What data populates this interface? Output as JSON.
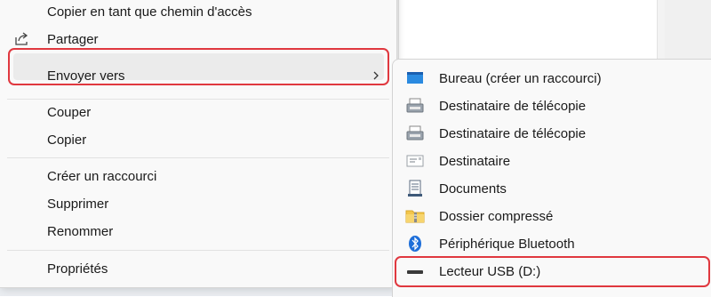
{
  "menu": {
    "items": [
      {
        "label": "Copier en tant que chemin d'accès",
        "icon": "copy-path-icon"
      },
      {
        "label": "Partager",
        "icon": "share-icon"
      },
      {
        "label": "Envoyer vers",
        "icon": "",
        "has_submenu": true,
        "highlighted": true
      },
      {
        "label": "Couper",
        "icon": ""
      },
      {
        "label": "Copier",
        "icon": ""
      },
      {
        "label": "Créer un raccourci",
        "icon": ""
      },
      {
        "label": "Supprimer",
        "icon": ""
      },
      {
        "label": "Renommer",
        "icon": ""
      },
      {
        "label": "Propriétés",
        "icon": ""
      }
    ]
  },
  "submenu": {
    "items": [
      {
        "label": "Bureau (créer un raccourci)",
        "icon": "desktop-icon"
      },
      {
        "label": "Destinataire de télécopie",
        "icon": "fax-icon"
      },
      {
        "label": "Destinataire de télécopie",
        "icon": "fax-icon"
      },
      {
        "label": "Destinataire",
        "icon": "mail-recipient-icon"
      },
      {
        "label": "Documents",
        "icon": "documents-icon"
      },
      {
        "label": "Dossier compressé",
        "icon": "zip-folder-icon"
      },
      {
        "label": "Périphérique Bluetooth",
        "icon": "bluetooth-icon"
      },
      {
        "label": "Lecteur USB (D:)",
        "icon": "usb-drive-icon",
        "highlighted": true
      }
    ]
  },
  "colors": {
    "highlight_border": "#e0383f",
    "menu_bg": "#f9f9f9",
    "hover_bg": "#ebebeb",
    "bluetooth": "#1e6fd9",
    "desktop": "#2a8ae0"
  }
}
